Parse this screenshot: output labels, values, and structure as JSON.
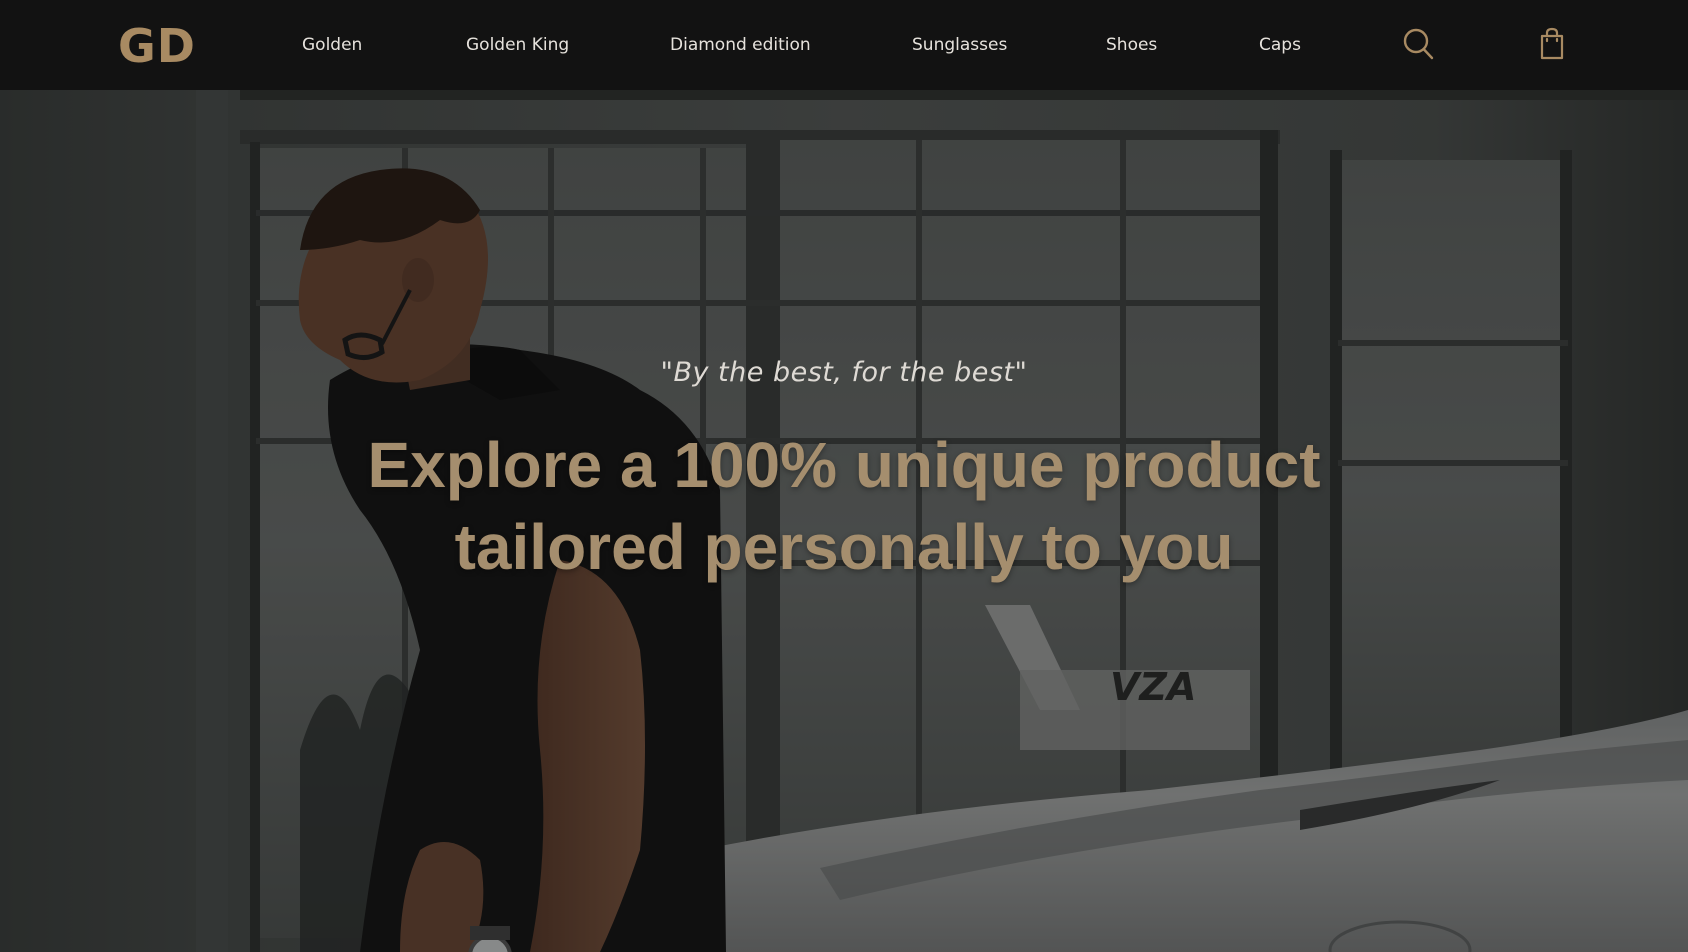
{
  "brand": {
    "logo_text": "GD",
    "accent_color": "#a88a62",
    "headline_color": "#a58e6e",
    "nav_background": "#121212"
  },
  "nav": {
    "links": [
      {
        "label": "Golden"
      },
      {
        "label": "Golden King"
      },
      {
        "label": "Diamond edition"
      },
      {
        "label": "Sunglasses"
      },
      {
        "label": "Shoes"
      },
      {
        "label": "Caps"
      }
    ],
    "icons": {
      "search": "search-icon",
      "cart": "shopping-bag-icon"
    }
  },
  "hero": {
    "tagline": "\"By the best, for the best\"",
    "headline_line1": "Explore a 100% unique product",
    "headline_line2": "tailored personally to you",
    "background_image": "photo of a man in a dark polo shirt and glasses leaning on a white car in a hangar with large windows",
    "plate_text": "VZA"
  }
}
